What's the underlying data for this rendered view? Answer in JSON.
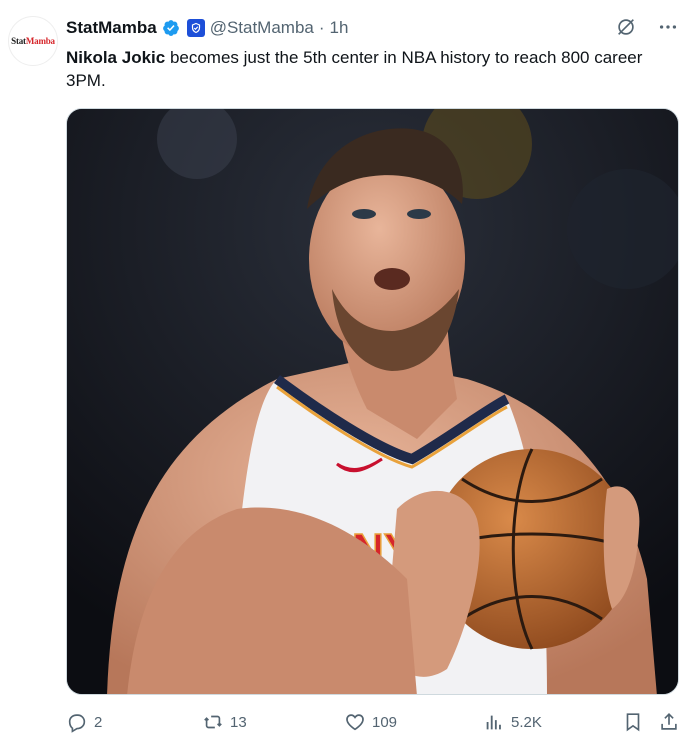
{
  "post": {
    "author_name": "StatMamba",
    "handle": "@StatMamba",
    "separator": "·",
    "time": "1h",
    "avatar_text_a": "Stat",
    "avatar_text_b": "Mamba",
    "text_bold": "Nikola Jokic",
    "text_rest": " becomes just the 5th center in NBA history to reach 800 career 3PM.",
    "media_alt_icons": [
      "jersey",
      "basketball"
    ]
  },
  "stats": {
    "replies": "2",
    "reposts": "13",
    "likes": "109",
    "views": "5.2K"
  },
  "colors": {
    "verified": "#1d9bf0",
    "affiliate": "#1d4fd8",
    "muted": "#536471",
    "jersey_navy": "#1f2a4a",
    "jersey_gold": "#e9a23b"
  }
}
